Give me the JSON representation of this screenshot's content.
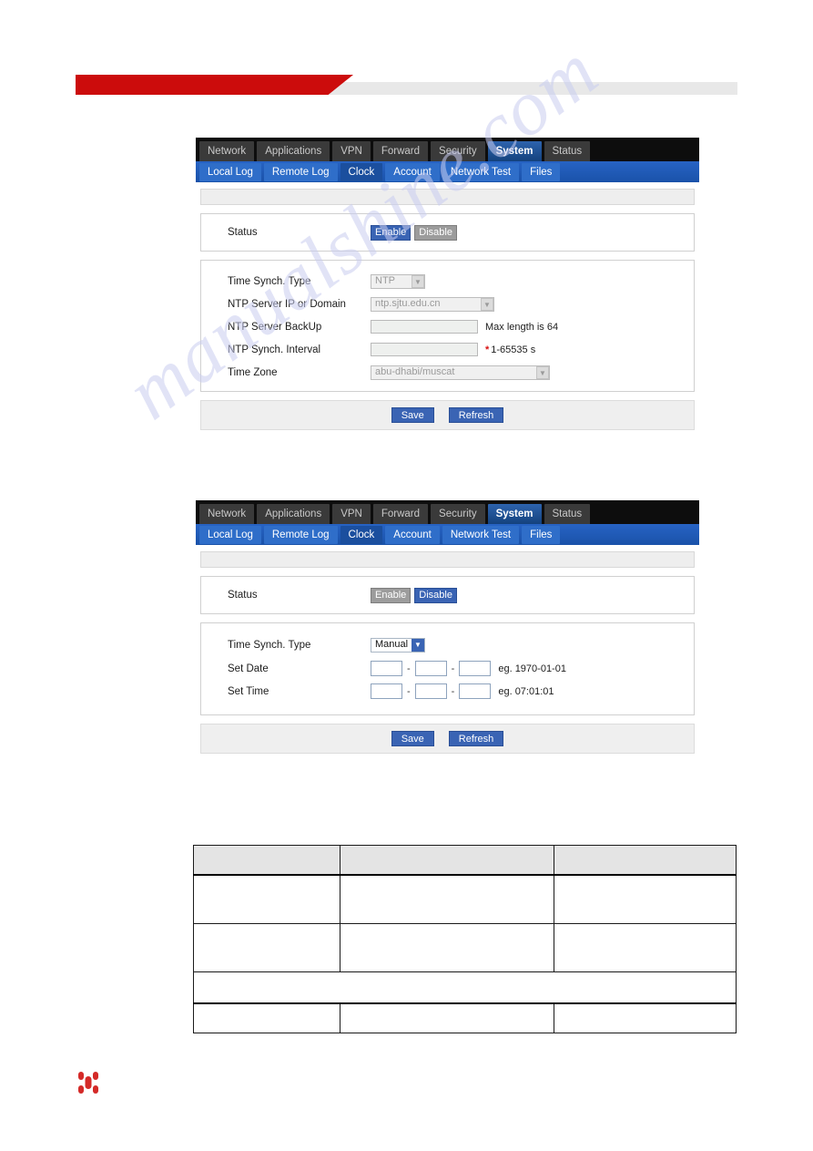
{
  "header": {
    "banner_red_color": "#cc0c0c",
    "banner_gray_color": "#e8e8e8"
  },
  "watermark": {
    "text": "manualshine.com",
    "color": "#c9cdf0"
  },
  "router_ui": {
    "top_nav": [
      {
        "label": "Network",
        "active": false
      },
      {
        "label": "Applications",
        "active": false
      },
      {
        "label": "VPN",
        "active": false
      },
      {
        "label": "Forward",
        "active": false
      },
      {
        "label": "Security",
        "active": false
      },
      {
        "label": "System",
        "active": true
      },
      {
        "label": "Status",
        "active": false
      }
    ],
    "sub_nav": [
      {
        "label": "Local Log",
        "active": false
      },
      {
        "label": "Remote Log",
        "active": false
      },
      {
        "label": "Clock",
        "active": true
      },
      {
        "label": "Account",
        "active": false
      },
      {
        "label": "Network Test",
        "active": false
      },
      {
        "label": "Files",
        "active": false
      }
    ],
    "accent_blue": "#3a64b4",
    "nav_blue": "#1e5bb8",
    "nav_dark": "#0d0d0d"
  },
  "panel_ntp": {
    "status_label": "Status",
    "enable_label": "Enable",
    "disable_label": "Disable",
    "selected": "Enable",
    "fields": {
      "time_synch_type_label": "Time Synch. Type",
      "time_synch_type_value": "NTP",
      "ntp_server_label": "NTP Server IP or Domain",
      "ntp_server_value": "ntp.sjtu.edu.cn",
      "ntp_backup_label": "NTP Server BackUp",
      "ntp_backup_value": "",
      "ntp_backup_hint": "Max length is 64",
      "ntp_interval_label": "NTP Synch. Interval",
      "ntp_interval_value": "",
      "ntp_interval_required": "*",
      "ntp_interval_hint": "1-65535 s",
      "time_zone_label": "Time Zone",
      "time_zone_value": "abu-dhabi/muscat"
    },
    "buttons": {
      "save": "Save",
      "refresh": "Refresh"
    }
  },
  "panel_manual": {
    "status_label": "Status",
    "enable_label": "Enable",
    "disable_label": "Disable",
    "selected": "Disable",
    "fields": {
      "time_synch_type_label": "Time Synch. Type",
      "time_synch_type_value": "Manual",
      "set_date_label": "Set Date",
      "set_date_year": "",
      "set_date_month": "",
      "set_date_day": "",
      "set_date_hint": "eg. 1970-01-01",
      "set_time_label": "Set Time",
      "set_time_hour": "",
      "set_time_minute": "",
      "set_time_second": "",
      "set_time_hint": "eg. 07:01:01",
      "separator": "-"
    },
    "buttons": {
      "save": "Save",
      "refresh": "Refresh"
    }
  },
  "doc_table": {
    "header_row": [
      "",
      "",
      ""
    ],
    "rows": [
      [
        "",
        "",
        ""
      ],
      [
        "",
        "",
        ""
      ],
      [
        ""
      ],
      [
        "",
        "",
        ""
      ]
    ]
  },
  "footer": {
    "logo_color": "#d42a28"
  }
}
